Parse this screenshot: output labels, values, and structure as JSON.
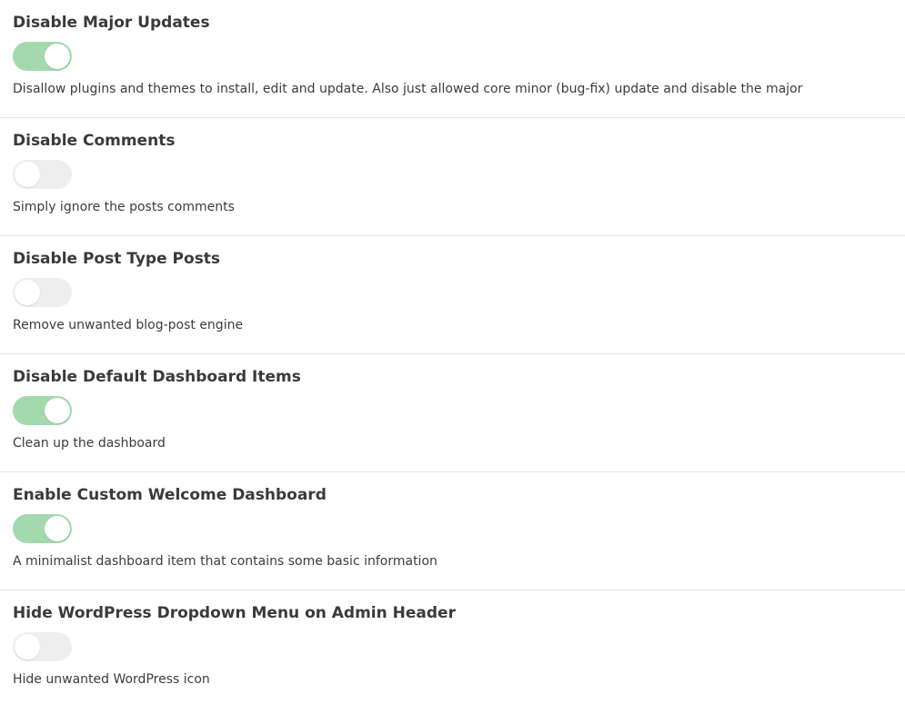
{
  "colors": {
    "toggle_on": "#a3d9ad",
    "toggle_off": "#eeeeee",
    "knob": "#ffffff",
    "divider": "#e6e6e6"
  },
  "settings": [
    {
      "title": "Disable Major Updates",
      "enabled": true,
      "description": "Disallow plugins and themes to install, edit and update. Also just allowed core minor (bug-fix) update and disable the major"
    },
    {
      "title": "Disable Comments",
      "enabled": false,
      "description": "Simply ignore the posts comments"
    },
    {
      "title": "Disable Post Type Posts",
      "enabled": false,
      "description": "Remove unwanted blog-post engine"
    },
    {
      "title": "Disable Default Dashboard Items",
      "enabled": true,
      "description": "Clean up the dashboard"
    },
    {
      "title": "Enable Custom Welcome Dashboard",
      "enabled": true,
      "description": "A minimalist dashboard item that contains some basic information"
    },
    {
      "title": "Hide WordPress Dropdown Menu on Admin Header",
      "enabled": false,
      "description": "Hide unwanted WordPress icon"
    }
  ]
}
